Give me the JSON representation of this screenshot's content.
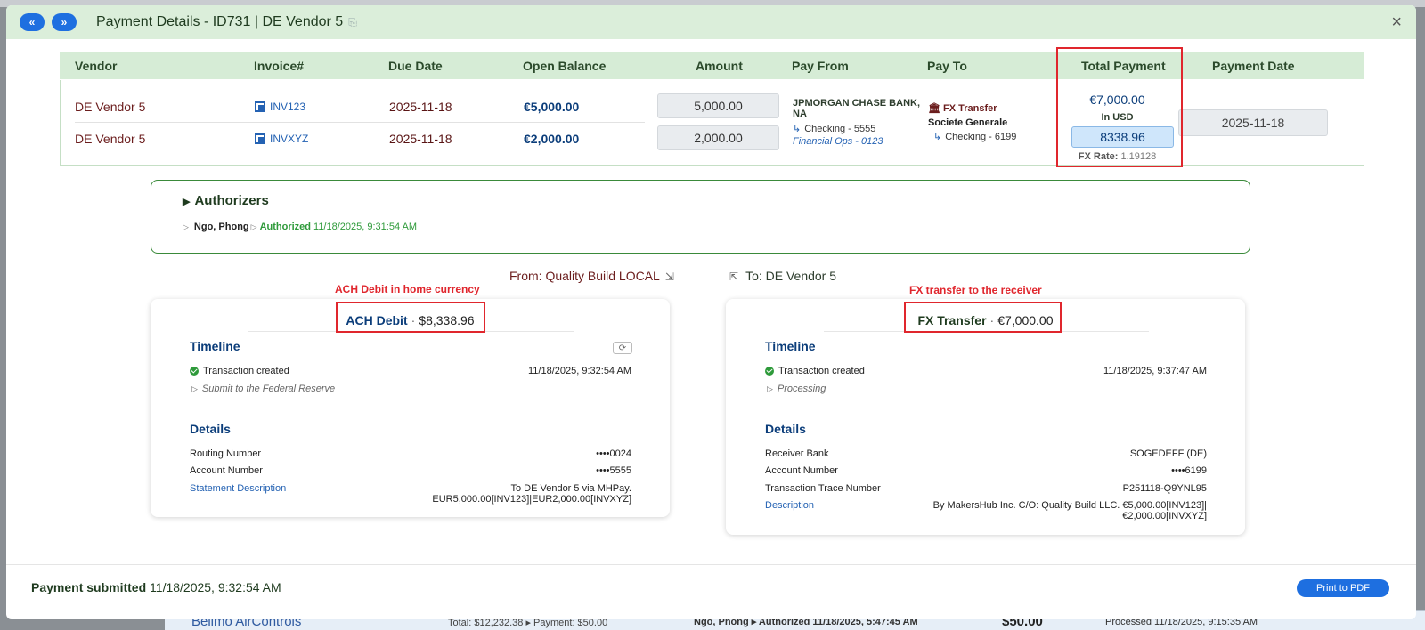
{
  "header": {
    "prev_label": "«",
    "next_label": "»",
    "title": "Payment Details - ID731 | DE Vendor 5",
    "close_label": "×"
  },
  "table": {
    "columns": [
      "Vendor",
      "Invoice#",
      "Due Date",
      "Open Balance",
      "Amount",
      "Pay From",
      "Pay To",
      "Total Payment",
      "Payment Date"
    ],
    "rows": [
      {
        "vendor": "DE Vendor 5",
        "invoice": "INV123",
        "due_date": "2025-11-18",
        "open_balance": "€5,000.00",
        "amount": "5,000.00"
      },
      {
        "vendor": "DE Vendor 5",
        "invoice": "INVXYZ",
        "due_date": "2025-11-18",
        "open_balance": "€2,000.00",
        "amount": "2,000.00"
      }
    ],
    "pay_from": {
      "bank": "JPMORGAN CHASE BANK, NA",
      "account": "Checking - 5555",
      "ops": "Financial Ops - 0123"
    },
    "pay_to": {
      "type": "FX Transfer",
      "bank": "Societe Generale",
      "account": "Checking - 6199"
    },
    "total": {
      "eur": "€7,000.00",
      "in_usd_label": "In USD",
      "usd": "8338.96",
      "fx_label": "FX Rate:",
      "fx_value": "1.19128"
    },
    "payment_date": "2025-11-18"
  },
  "authorizers": {
    "title": "Authorizers",
    "name": "Ngo, Phong",
    "status": "Authorized",
    "timestamp": "11/18/2025, 9:31:54 AM"
  },
  "from_label": "From: Quality Build LOCAL",
  "to_label": "To: DE Vendor 5",
  "annotations": {
    "left": "ACH Debit in home currency",
    "right": "FX transfer to the receiver"
  },
  "ach_card": {
    "kind": "ACH Debit",
    "amount": "$8,338.96",
    "timeline_title": "Timeline",
    "event": "Transaction created",
    "event_time": "11/18/2025, 9:32:54 AM",
    "next_step": "Submit to the Federal Reserve",
    "details_title": "Details",
    "details": [
      {
        "label": "Routing Number",
        "value": "••••0024"
      },
      {
        "label": "Account Number",
        "value": "••••5555"
      },
      {
        "label": "Statement Description",
        "value": "To DE Vendor 5 via MHPay.",
        "value2": "EUR5,000.00[INV123]|EUR2,000.00[INVXYZ]"
      }
    ]
  },
  "fx_card": {
    "kind": "FX Transfer",
    "amount": "€7,000.00",
    "timeline_title": "Timeline",
    "event": "Transaction created",
    "event_time": "11/18/2025, 9:37:47 AM",
    "next_step": "Processing",
    "details_title": "Details",
    "details": [
      {
        "label": "Receiver Bank",
        "value": "SOGEDEFF (DE)"
      },
      {
        "label": "Account Number",
        "value": "••••6199"
      },
      {
        "label": "Transaction Trace Number",
        "value": "P251118-Q9YNL95"
      },
      {
        "label": "Description",
        "value": "By MakersHub Inc. C/O: Quality Build LLC. €5,000.00[INV123]|",
        "value2": "€2,000.00[INVXYZ]"
      }
    ]
  },
  "footer": {
    "status_label": "Payment submitted",
    "status_time": "11/18/2025, 9:32:54 AM",
    "pdf_label": "Print to PDF"
  },
  "background": {
    "vendor": "Belimo AirControls",
    "totals": "Total: $12,232.38 ▸ Payment: $50.00",
    "authorizer": "Ngo, Phong ▸ Authorized 11/18/2025, 5:47:45 AM",
    "amount": "$50.00",
    "status": "Processed 11/18/2025, 9:15:35 AM"
  }
}
